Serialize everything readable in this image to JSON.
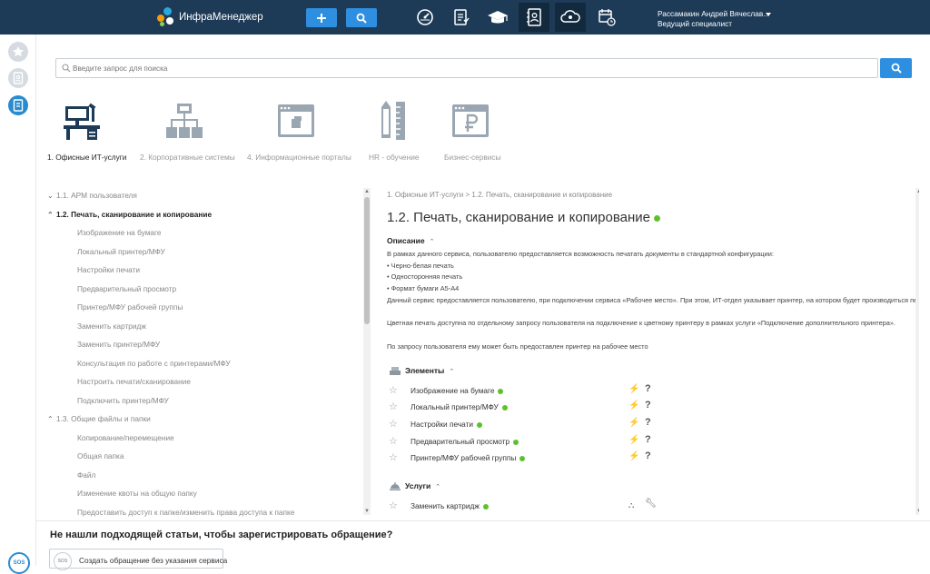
{
  "header": {
    "app_name": "ИнфраМенеджер",
    "user_name": "Рассамакин Андрей Вячеслав...",
    "user_role": "Ведущий специалист",
    "icons": [
      "dashboard-icon",
      "checklist-icon",
      "graduation-cap-icon",
      "phonebook-icon",
      "cloud-user-icon",
      "calendar-icon"
    ]
  },
  "search": {
    "placeholder": "Введите запрос для поиска"
  },
  "categories": [
    {
      "label": "1. Офисные ИТ-услуги",
      "icon": "workstation-icon",
      "active": true
    },
    {
      "label": "2. Корпоративные системы",
      "icon": "network-icon",
      "active": false
    },
    {
      "label": "4. Информационные порталы",
      "icon": "browser-icon",
      "active": false
    },
    {
      "label": "HR - обучение",
      "icon": "pencil-ruler-icon",
      "active": false
    },
    {
      "label": "Бизнес-сервисы",
      "icon": "ruble-icon",
      "active": false
    }
  ],
  "tree": [
    {
      "label": "1.1. АРМ пользователя",
      "level": 0,
      "chevron": "⌄",
      "bold": false
    },
    {
      "label": "1.2. Печать, сканирование и копирование",
      "level": 0,
      "chevron": "⌃",
      "bold": true
    },
    {
      "label": "Изображение на бумаге",
      "level": 1
    },
    {
      "label": "Локальный принтер/МФУ",
      "level": 1
    },
    {
      "label": "Настройки печати",
      "level": 1
    },
    {
      "label": "Предварительный просмотр",
      "level": 1
    },
    {
      "label": "Принтер/МФУ рабочей группы",
      "level": 1
    },
    {
      "label": "Заменить картридж",
      "level": 1
    },
    {
      "label": "Заменить принтер/МФУ",
      "level": 1
    },
    {
      "label": "Консультация по работе с принтерами/МФУ",
      "level": 1
    },
    {
      "label": "Настроить печати/сканирование",
      "level": 1
    },
    {
      "label": "Подключить принтер/МФУ",
      "level": 1
    },
    {
      "label": "1.3. Общие файлы и папки",
      "level": 0,
      "chevron": "⌃",
      "bold": false
    },
    {
      "label": "Копирование/перемещение",
      "level": 1
    },
    {
      "label": "Общая папка",
      "level": 1
    },
    {
      "label": "Файл",
      "level": 1
    },
    {
      "label": "Изменение квоты на общую папку",
      "level": 1
    },
    {
      "label": "Предоставить доступ к папке/изменить права доступа к папке",
      "level": 1
    }
  ],
  "content": {
    "breadcrumb": "1. Офисные ИТ-услуги > 1.2. Печать, сканирование и копирование",
    "title": "1.2. Печать, сканирование и копирование",
    "description_heading": "Описание",
    "description_lines": [
      "В рамках данного сервиса, пользователю предоставляется возможность печатать документы в стандартной конфигурации:",
      "• Черно-белая печать",
      "• Односторонняя печать",
      "• Формат бумаги А5-А4",
      "Данный сервис предоставляется пользователю, при подключении сервиса «Рабочее место». При этом, ИТ-отдел указывает принтер, на котором будет производиться печать.",
      "",
      "Цветная печать доступна по отдельному запросу пользователя на подключение к цветному принтеру в рамках услуги «Подключение дополнительного принтера».",
      "",
      "По запросу пользователя ему может быть предоставлен принтер на рабочее место"
    ],
    "elements_heading": "Элементы",
    "elements": [
      "Изображение на бумаге",
      "Локальный принтер/МФУ",
      "Настройки печати",
      "Предварительный просмотр",
      "Принтер/МФУ рабочей группы"
    ],
    "services_heading": "Услуги",
    "services": [
      "Заменить картридж"
    ]
  },
  "bottom": {
    "question": "Не нашли подходящей статьи, чтобы зарегистрировать обращение?",
    "button_label": "Создать обращение без указания сервиса",
    "button_icon_text": "SOS",
    "rail_bottom_text": "SOS"
  },
  "colors": {
    "topbar": "#1d3b57",
    "accent": "#2e8fe0",
    "status_green": "#5ec12a"
  }
}
